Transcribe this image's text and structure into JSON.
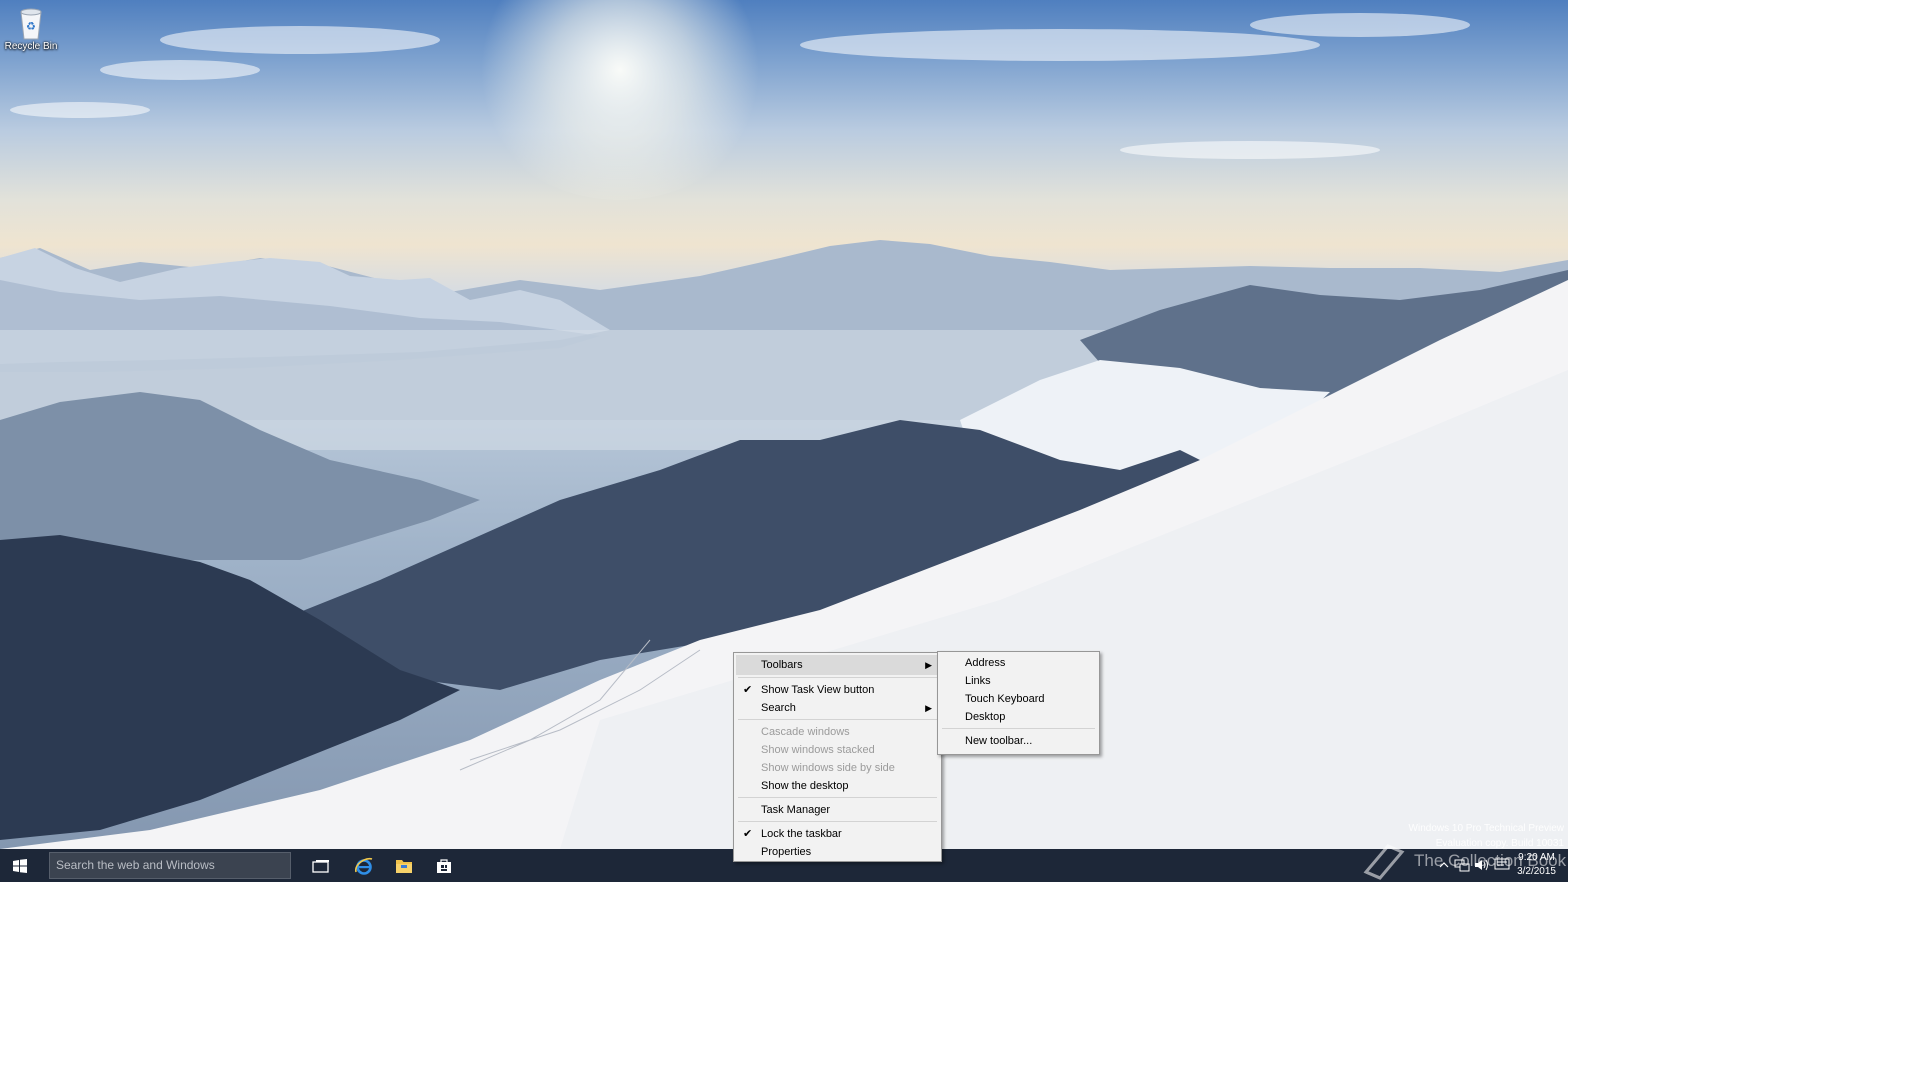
{
  "desktop": {
    "icons": [
      {
        "label": "Recycle Bin",
        "icon": "recycle-bin-icon"
      }
    ]
  },
  "watermark": {
    "line1": "Windows 10 Pro Technical Preview",
    "line2": "Evaluation copy. Build 10031",
    "collection_text": "The Collection Book"
  },
  "taskbar": {
    "search_placeholder": "Search the web and Windows",
    "pinned": [
      "task-view-icon",
      "internet-explorer-icon",
      "file-explorer-icon",
      "store-icon"
    ],
    "clock": {
      "time": "9:20 AM",
      "date": "3/2/2015"
    }
  },
  "context_menu": {
    "items": [
      {
        "label": "Toolbars",
        "submenu": true,
        "highlighted": true
      },
      {
        "label": "Show Task View button",
        "checked": true
      },
      {
        "label": "Search",
        "submenu": true
      },
      {
        "label": "Cascade windows",
        "disabled": true
      },
      {
        "label": "Show windows stacked",
        "disabled": true
      },
      {
        "label": "Show windows side by side",
        "disabled": true
      },
      {
        "label": "Show the desktop"
      },
      {
        "label": "Task Manager"
      },
      {
        "label": "Lock the taskbar",
        "checked": true
      },
      {
        "label": "Properties"
      }
    ]
  },
  "toolbars_submenu": {
    "items": [
      {
        "label": "Address"
      },
      {
        "label": "Links"
      },
      {
        "label": "Touch Keyboard"
      },
      {
        "label": "Desktop"
      },
      {
        "label": "New toolbar..."
      }
    ]
  },
  "colors": {
    "taskbar": "#1d2738",
    "menu_bg": "#f2f2f2",
    "menu_highlight": "#dadada",
    "disabled_text": "#9b9b9b"
  }
}
